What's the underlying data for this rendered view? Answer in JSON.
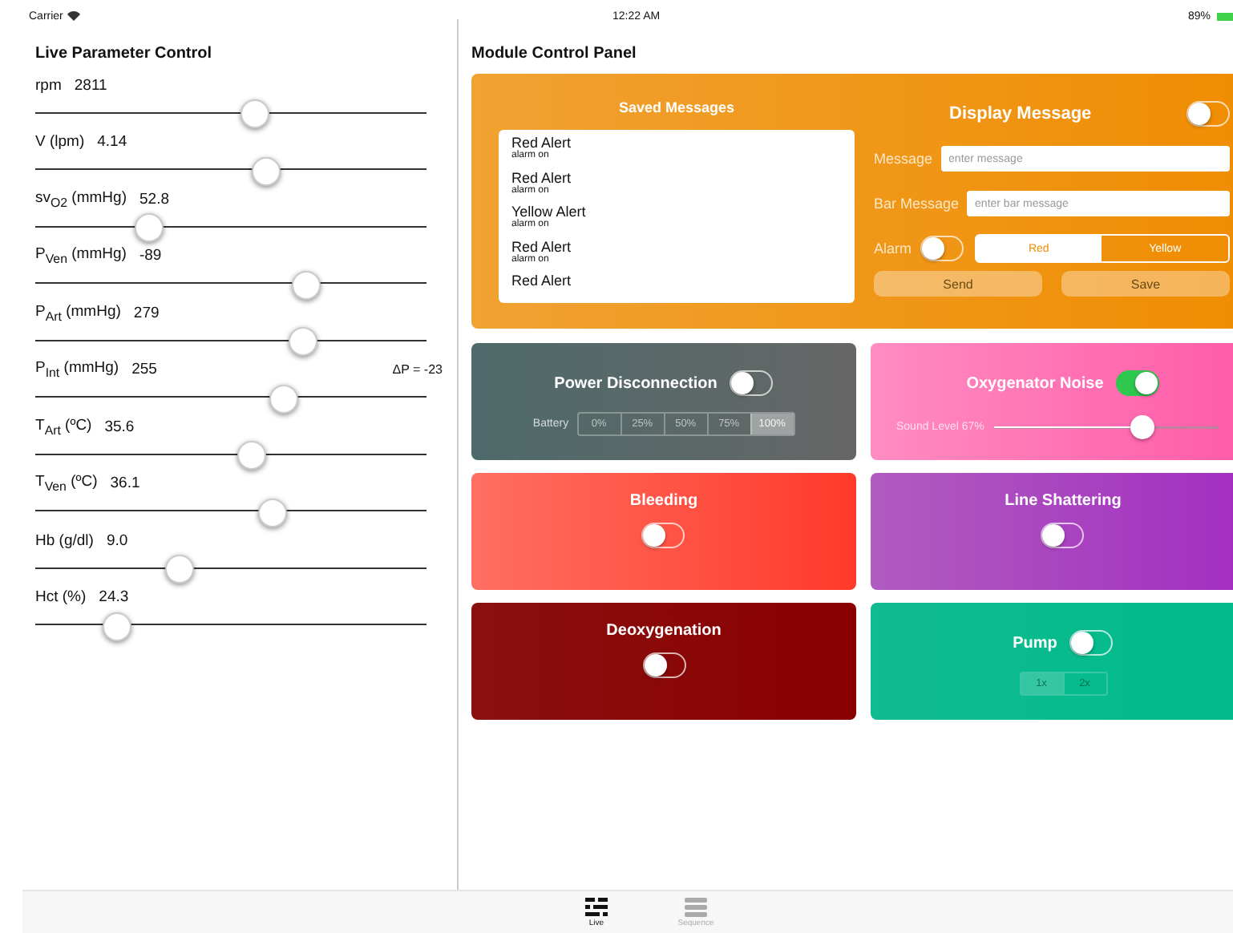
{
  "status_bar": {
    "carrier": "Carrier",
    "time": "12:22 AM",
    "battery": "89%"
  },
  "left_panel": {
    "title": "Live Parameter Control",
    "parameters": [
      {
        "label": "rpm",
        "value": "2811",
        "level": 0.557
      },
      {
        "label": "V (lpm)",
        "value": "4.14",
        "level": 0.586
      },
      {
        "label": "sv$_{O2}$ (mmHg)",
        "value": "52.8",
        "level": 0.287
      },
      {
        "label": "P$_{Ven}$ (mmHg)",
        "value": "-89",
        "level": 0.689
      },
      {
        "label": "P$_{Art}$ (mmHg)",
        "value": "279",
        "level": 0.68
      },
      {
        "label": "P$_{Int}$ (mmHg)",
        "value": "255",
        "level": 0.631,
        "note": "ΔP = -23"
      },
      {
        "label": "T$_{Art}$ (ºC)",
        "value": "35.6",
        "level": 0.549
      },
      {
        "label": "T$_{Ven}$ (ºC)",
        "value": "36.1",
        "level": 0.602
      },
      {
        "label": "Hb (g/dl)",
        "value": "9.0",
        "level": 0.365
      },
      {
        "label": "Hct (%)",
        "value": "24.3",
        "level": 0.205
      }
    ]
  },
  "right_panel": {
    "title": "Module Control Panel",
    "message_panel": {
      "saved_title": "Saved Messages",
      "saved_messages": [
        {
          "title": "Red Alert",
          "subtitle": "alarm on"
        },
        {
          "title": "Red Alert",
          "subtitle": "alarm on"
        },
        {
          "title": "Yellow Alert",
          "subtitle": "alarm on"
        },
        {
          "title": "Red Alert",
          "subtitle": "alarm on"
        },
        {
          "title": "Red Alert"
        }
      ],
      "display_title": "Display Message",
      "display_on": false,
      "fields": [
        {
          "label": "Message",
          "placeholder": "enter message"
        },
        {
          "label": "Bar Message",
          "placeholder": "enter bar message"
        }
      ],
      "alarm": {
        "label": "Alarm",
        "on": false,
        "options": [
          {
            "label": "Red",
            "selected": true
          },
          {
            "label": "Yellow",
            "selected": false
          }
        ]
      },
      "buttons": [
        "Send",
        "Save"
      ]
    },
    "cards": [
      {
        "kind": "battery",
        "title": "Power Disconnection",
        "on": false,
        "color": "#4e6a6a",
        "segments": {
          "label": "Battery",
          "disabled": false,
          "options": [
            {
              "label": "0%",
              "selected": false
            },
            {
              "label": "25%",
              "selected": false
            },
            {
              "label": "50%",
              "selected": false
            },
            {
              "label": "75%",
              "selected": false
            },
            {
              "label": "100%",
              "selected": true
            }
          ]
        }
      },
      {
        "kind": "sound",
        "title": "Oxygenator Noise",
        "on": true,
        "color": "#ff8cc0",
        "reading": "Sound Level 67%",
        "level": 0.66
      },
      {
        "kind": "plain",
        "title": "Bleeding",
        "on": false,
        "color": "#ff6f63"
      },
      {
        "kind": "plain",
        "title": "Line Shattering",
        "on": false,
        "color": "#b05cc0"
      },
      {
        "kind": "plain",
        "title": "Deoxygenation",
        "on": false,
        "color": "#8a1010"
      },
      {
        "kind": "pump",
        "title": "Pump",
        "on": false,
        "color": "#0fbb90",
        "segments": {
          "disabled": true,
          "options": [
            {
              "label": "1x",
              "selected": true
            },
            {
              "label": "2x",
              "selected": false
            }
          ]
        }
      }
    ]
  },
  "tab_bar": [
    {
      "label": "Live",
      "selected": true
    },
    {
      "label": "Sequence",
      "selected": false
    }
  ]
}
